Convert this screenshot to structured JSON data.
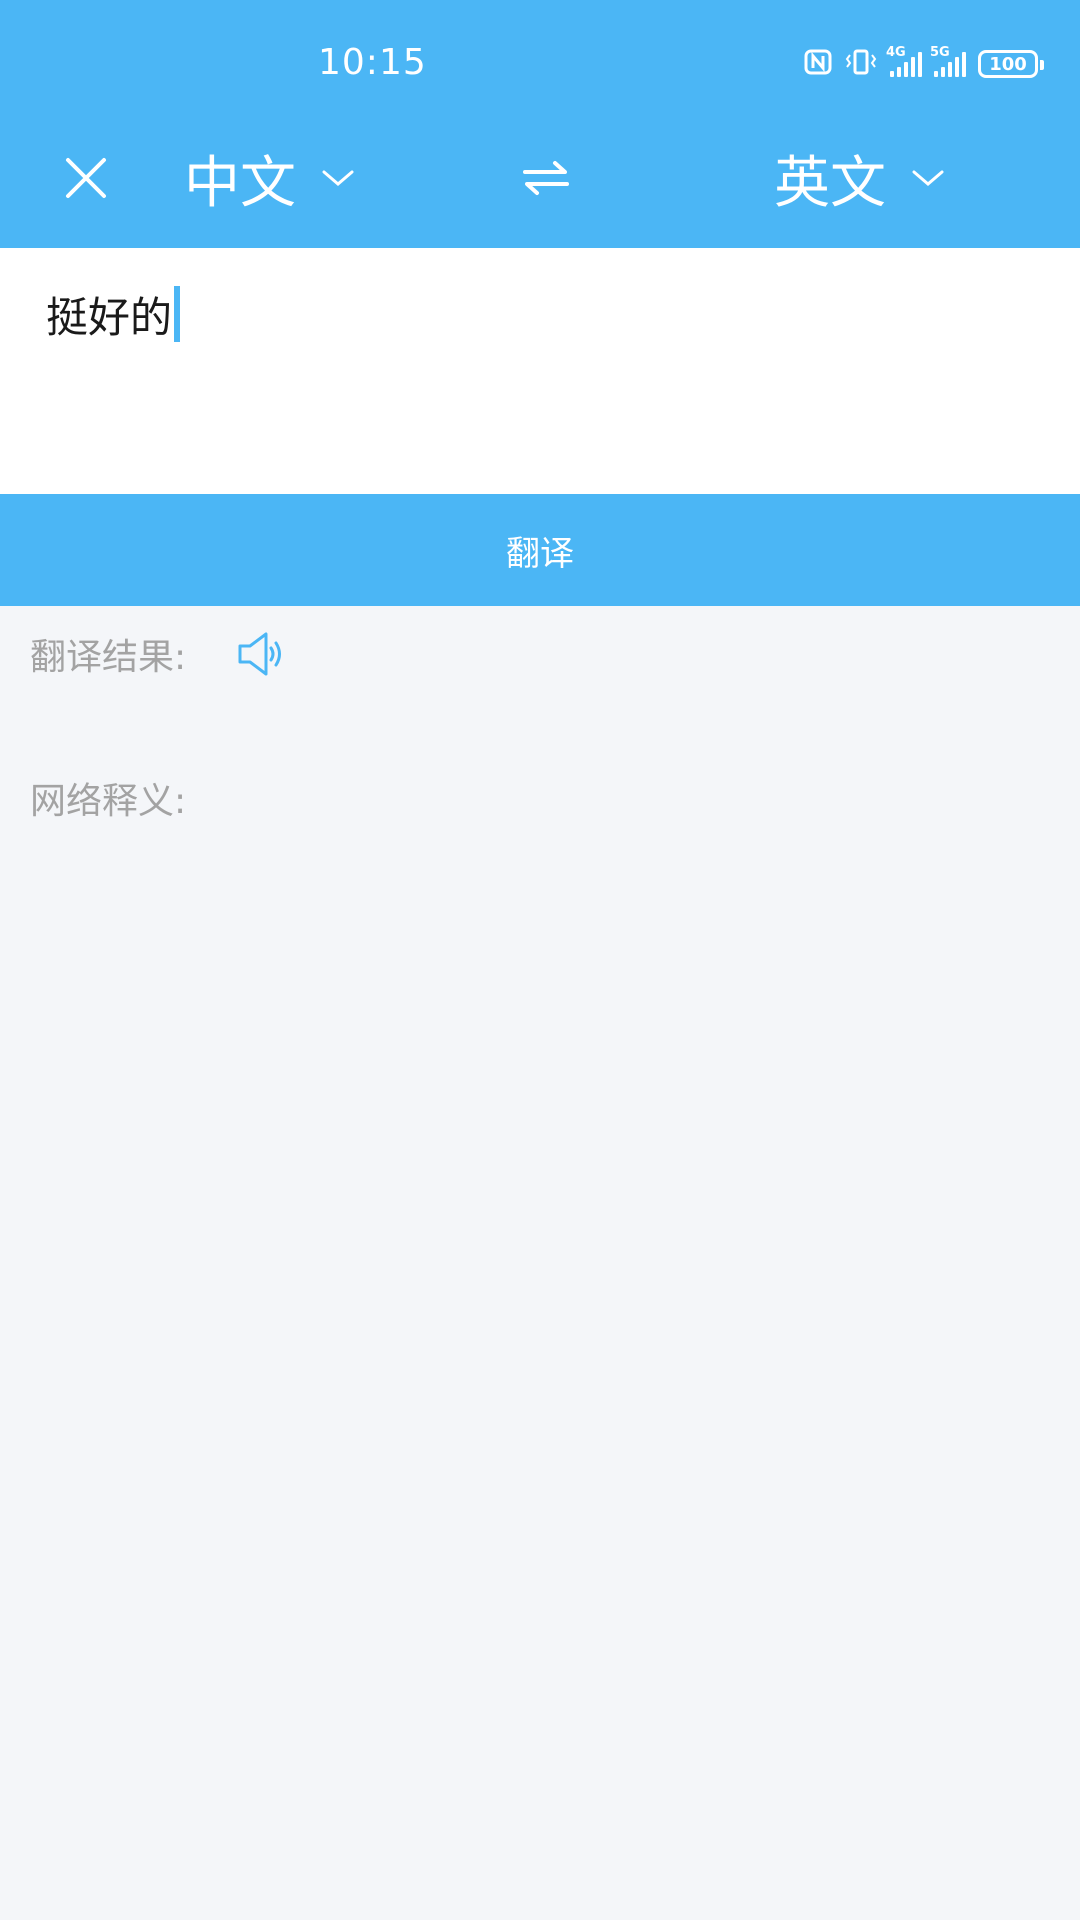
{
  "status_bar": {
    "time": "10:15",
    "network_1": "4G",
    "network_2": "5G",
    "battery": "100"
  },
  "toolbar": {
    "source_lang": "中文",
    "target_lang": "英文",
    "close_icon": "close-icon",
    "swap_icon": "swap-arrows-icon",
    "dropdown_icon": "chevron-down-icon"
  },
  "input": {
    "value": "挺好的"
  },
  "translate_button": {
    "label": "翻译"
  },
  "results": {
    "translation_label": "翻译结果:",
    "speaker_icon": "speaker-icon",
    "web_meaning_label": "网络释义:"
  },
  "colors": {
    "accent": "#4bb6f5",
    "background": "#f4f6f9",
    "label_gray": "#a3a3a3"
  }
}
